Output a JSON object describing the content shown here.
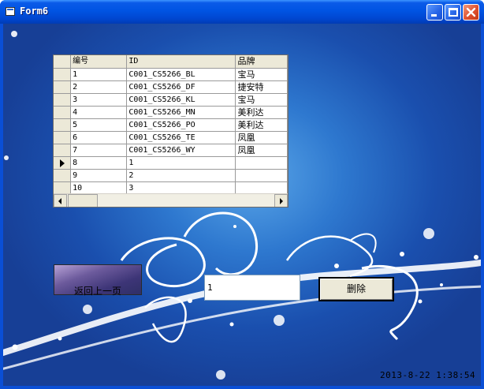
{
  "window": {
    "title": "Form6",
    "icons": [
      "app-icon",
      "minimize-icon",
      "maximize-icon",
      "close-icon"
    ]
  },
  "grid": {
    "columns": [
      "编号",
      "ID",
      "品牌"
    ],
    "rows": [
      [
        "1",
        "C001_CS5266_BL",
        "宝马"
      ],
      [
        "2",
        "C001_CS5266_DF",
        "捷安特"
      ],
      [
        "3",
        "C001_CS5266_KL",
        "宝马"
      ],
      [
        "4",
        "C001_CS5266_MN",
        "美利达"
      ],
      [
        "5",
        "C001_CS5266_PO",
        "美利达"
      ],
      [
        "6",
        "C001_CS5266_TE",
        "凤凰"
      ],
      [
        "7",
        "C001_CS5266_WY",
        "凤凰"
      ],
      [
        "8",
        "1",
        ""
      ],
      [
        "9",
        "2",
        ""
      ],
      [
        "10",
        "3",
        ""
      ]
    ],
    "current_row_index": 7
  },
  "back_button": {
    "label": "返回上一页"
  },
  "delete_input": {
    "value": "1"
  },
  "delete_button": {
    "label": "删除"
  },
  "status": {
    "datetime": "2013-8-22  1:38:54"
  },
  "colors": {
    "titlebar": "#0054e3",
    "background": "#2e78cf",
    "grid_header": "#ece9d8"
  }
}
